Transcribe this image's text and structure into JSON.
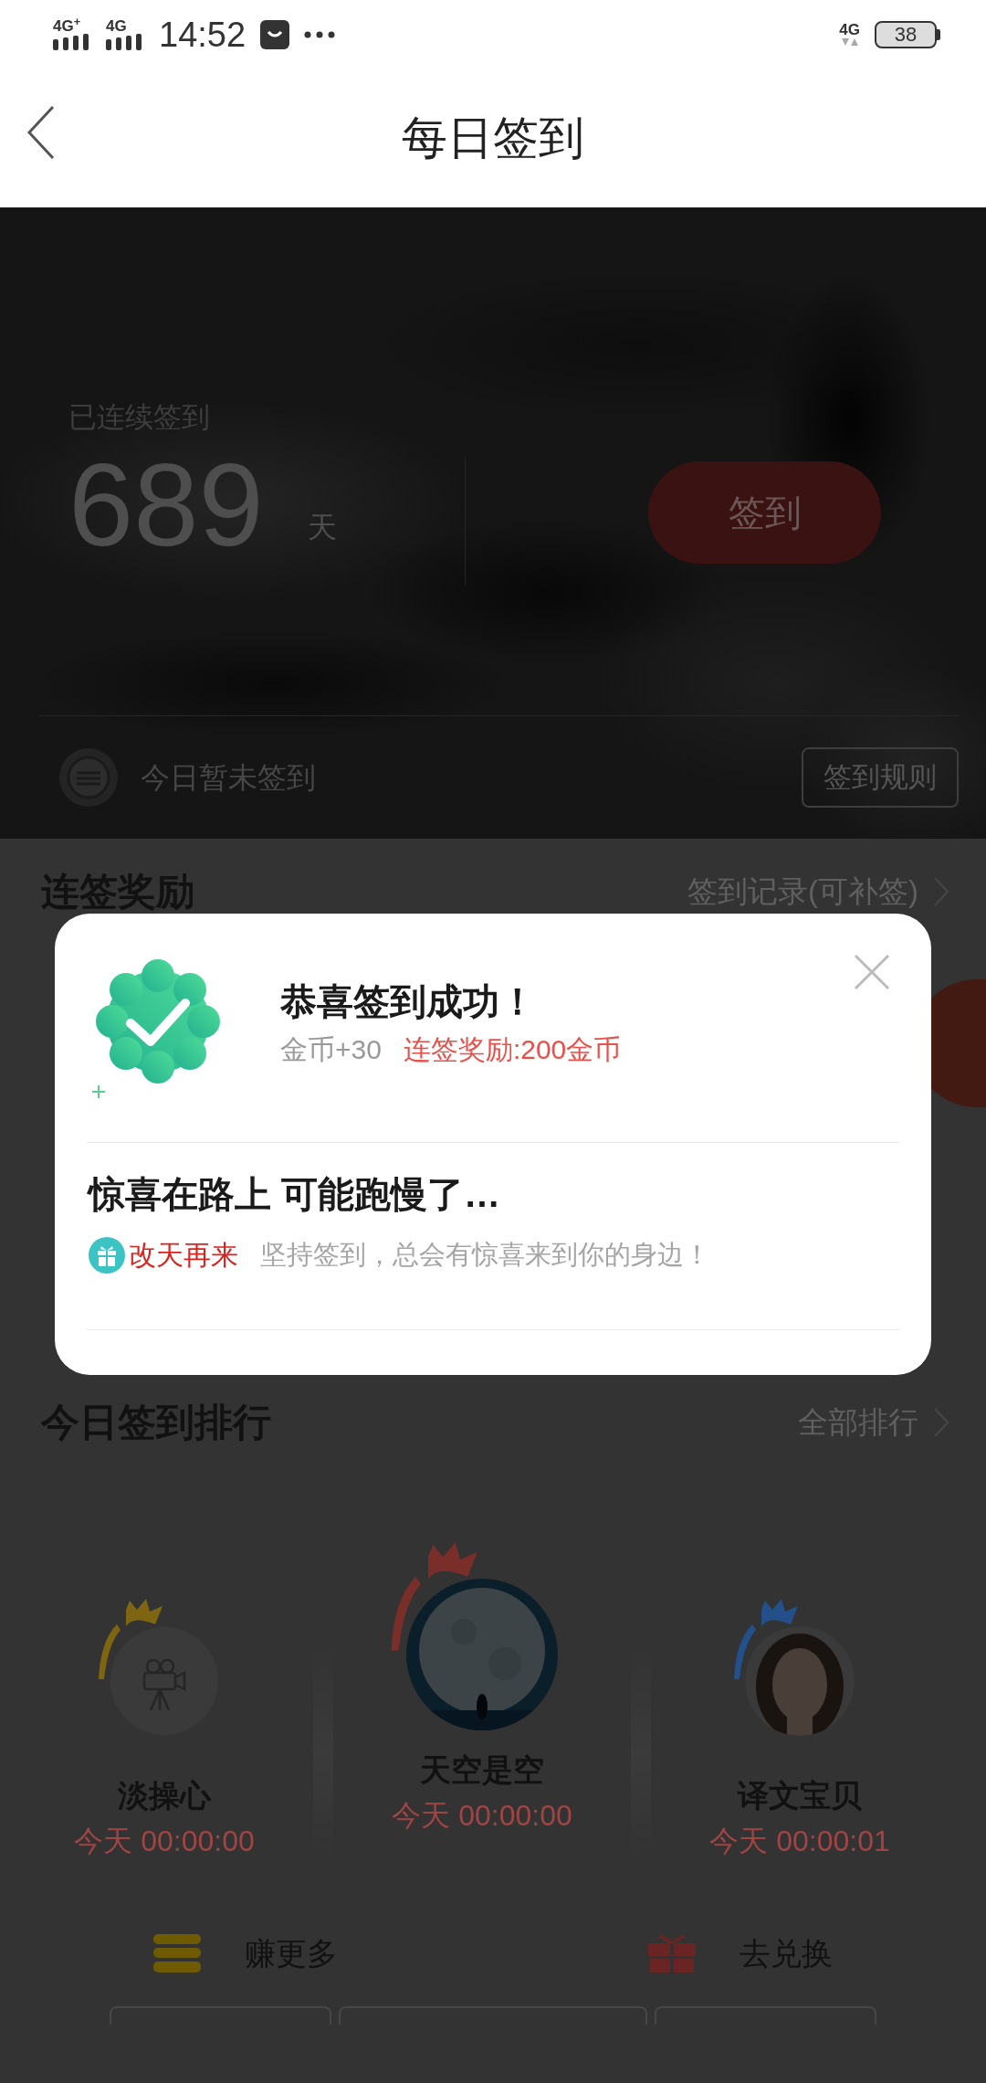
{
  "status_bar": {
    "networks": [
      {
        "label": "4G$^{+}$"
      },
      {
        "label": "4G"
      }
    ],
    "time": "14:52",
    "data_network": "4G",
    "battery": "38"
  },
  "header": {
    "title": "每日签到"
  },
  "hero": {
    "label": "已连续签到",
    "days": "689",
    "unit": "天",
    "sign_button": "签到",
    "status": "今日暂未签到",
    "rules_button": "签到规则"
  },
  "streak_rewards": {
    "title": "连签奖励",
    "link": "签到记录(可补签)"
  },
  "dialog": {
    "title": "恭喜签到成功！",
    "coins": "金币+30",
    "bonus": "连签奖励:200金币",
    "subtitle": "惊喜在路上 可能跑慢了…",
    "tag": "改天再来",
    "message": "坚持签到，总会有惊喜来到你的身边！"
  },
  "ranking": {
    "title": "今日签到排行",
    "link": "全部排行",
    "users": [
      {
        "name": "淡操心",
        "time": "今天 00:00:00",
        "color": "#7d6512",
        "raised": false,
        "kind": "icon"
      },
      {
        "name": "天空是空",
        "time": "今天 00:00:00",
        "color": "#7a2e2a",
        "raised": true,
        "kind": "picture"
      },
      {
        "name": "译文宝贝",
        "time": "今天 00:00:01",
        "color": "#23508a",
        "raised": false,
        "kind": "picture"
      }
    ]
  },
  "actions": [
    {
      "label": "赚更多",
      "kind": "coins"
    },
    {
      "label": "去兑换",
      "kind": "gift"
    }
  ]
}
